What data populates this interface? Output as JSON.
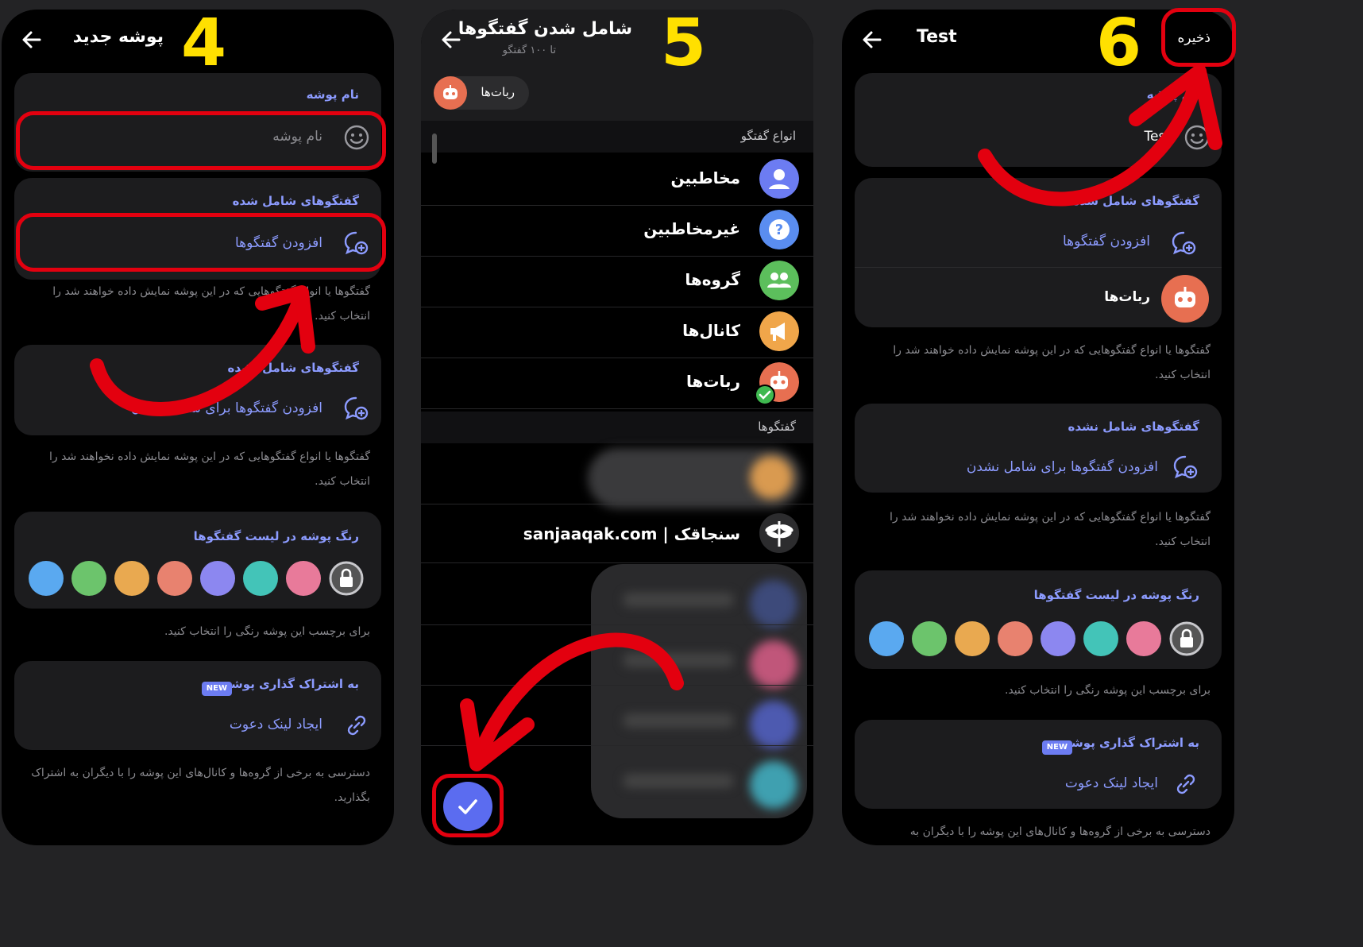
{
  "steps": {
    "step4": "4",
    "step5": "5",
    "step6": "6"
  },
  "screen1": {
    "title": "پوشه جدید",
    "folder_name_label": "نام پوشه",
    "folder_name_placeholder": "نام پوشه",
    "included_title": "گفتگوهای شامل شده",
    "add_chats": "افزودن گفتگوها",
    "included_note": "گفتگوها یا انواع گفتگوهایی که در این پوشه نمایش داده خواهند شد را انتخاب کنید.",
    "excluded_title": "گفتگوهای شامل نشده",
    "add_excluded": "افزودن گفتگوها برای شامل نشدن",
    "excluded_note": "گفتگوها یا انواع گفتگوهایی که در این پوشه نمایش داده نخواهند شد را انتخاب کنید.",
    "color_title": "رنگ پوشه در لیست گفتگوها",
    "color_note": "برای برچسب این پوشه رنگی را انتخاب کنید.",
    "share_title": "به اشتراک گذاری پوشه",
    "new_badge": "NEW",
    "invite_link": "ایجاد لینک دعوت",
    "share_note": "دسترسی به برخی از گروه‌ها و کانال‌های این پوشه را با دیگران به اشتراک بگذارید."
  },
  "screen2": {
    "title": "شامل شدن گفتگوها",
    "subtitle": "تا ۱۰۰ گفتگو",
    "chip": "ربات‌ها",
    "types_header": "انواع گفتگو",
    "types": [
      {
        "label": "مخاطبین",
        "icon": "person-icon",
        "color": "#6c7cf2"
      },
      {
        "label": "غیرمخاطبین",
        "icon": "question-icon",
        "color": "#5a8df0"
      },
      {
        "label": "گروه‌ها",
        "icon": "group-icon",
        "color": "#5cbf5c"
      },
      {
        "label": "کانال‌ها",
        "icon": "megaphone-icon",
        "color": "#f0a64a"
      },
      {
        "label": "ربات‌ها",
        "icon": "robot-icon",
        "color": "#e76f51",
        "checked": true
      }
    ],
    "chats_header": "گفتگوها",
    "chat_named": "سنجاقک | sanjaaqak.com"
  },
  "screen3": {
    "title": "Test",
    "save": "ذخیره",
    "folder_name_label": "نام پوشه",
    "folder_name_value": "Test",
    "included_title": "گفتگوهای شامل شده",
    "add_chats": "افزودن گفتگوها",
    "bots_row": "ربات‌ها",
    "included_note": "گفتگوها یا انواع گفتگوهایی که در این پوشه نمایش داده خواهند شد را انتخاب کنید.",
    "excluded_title": "گفتگوهای شامل نشده",
    "add_excluded": "افزودن گفتگوها برای شامل نشدن",
    "excluded_note": "گفتگوها یا انواع گفتگوهایی که در این پوشه نمایش داده نخواهند شد را انتخاب کنید.",
    "color_title": "رنگ پوشه در لیست گفتگوها",
    "color_note": "برای برچسب این پوشه رنگی را انتخاب کنید.",
    "share_title": "به اشتراک گذاری پوشه",
    "new_badge": "NEW",
    "invite_link": "ایجاد لینک دعوت",
    "share_note": "دسترسی به برخی از گروه‌ها و کانال‌های این پوشه را با دیگران به"
  },
  "folder_colors": [
    "#5aa9f0",
    "#6cc46c",
    "#e9a950",
    "#e8826f",
    "#8c87f0",
    "#43c4b8",
    "#e87a9a"
  ],
  "accent": "#8c9bff",
  "highlight": "#e3000f"
}
